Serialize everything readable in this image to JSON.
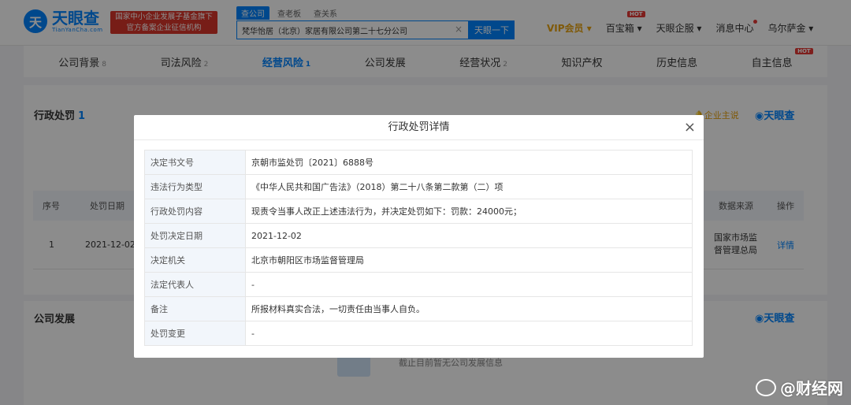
{
  "header": {
    "logo_mark": "天",
    "logo_text": "天眼查",
    "logo_sub": "TianYanCha.com",
    "banner_line1": "国家中小企业发展子基金旗下",
    "banner_line2": "官方备案企业征信机构",
    "search_tabs": [
      "查公司",
      "查老板",
      "查关系"
    ],
    "search_value": "梵华怡居（北京）家居有限公司第二十七分公司",
    "search_button": "天眼一下",
    "nav": {
      "vip": "VIP会员 ▾",
      "baibaoxiang": "百宝箱 ▾",
      "qifu": "天眼企服 ▾",
      "messages": "消息中心",
      "user": "乌尔萨金 ▾",
      "hot": "HOT"
    }
  },
  "company_tabs": [
    {
      "label": "公司背景",
      "count": "8"
    },
    {
      "label": "司法风险",
      "count": "2"
    },
    {
      "label": "经营风险",
      "count": "1"
    },
    {
      "label": "公司发展",
      "count": ""
    },
    {
      "label": "经营状况",
      "count": "2"
    },
    {
      "label": "知识产权",
      "count": ""
    },
    {
      "label": "历史信息",
      "count": ""
    },
    {
      "label": "自主信息",
      "count": ""
    }
  ],
  "tab_hot": "HOT",
  "section_penalty": {
    "title": "行政处罚",
    "count": "1",
    "alert": "企业主说",
    "brand": "天眼查"
  },
  "table": {
    "headers": [
      "序号",
      "处罚日期",
      "数据来源",
      "操作"
    ],
    "row": {
      "index": "1",
      "date": "2021-12-02",
      "source_line1": "国家市场监",
      "source_line2": "督管理总局",
      "action": "详情"
    }
  },
  "section_dev": {
    "title": "公司发展",
    "brand": "天眼查",
    "empty_text": "截止目前暂无公司发展信息"
  },
  "modal": {
    "title": "行政处罚详情",
    "close": "×",
    "rows": [
      {
        "label": "决定书文号",
        "value": "京朝市监处罚〔2021〕6888号"
      },
      {
        "label": "违法行为类型",
        "value": "《中华人民共和国广告法》（2018）第二十八条第二款第（二）项"
      },
      {
        "label": "行政处罚内容",
        "value": "现责令当事人改正上述违法行为，并决定处罚如下：罚款：24000元；"
      },
      {
        "label": "处罚决定日期",
        "value": "2021-12-02"
      },
      {
        "label": "决定机关",
        "value": "北京市朝阳区市场监督管理局"
      },
      {
        "label": "法定代表人",
        "value": "-"
      },
      {
        "label": "备注",
        "value": "所报材料真实合法，一切责任由当事人自负。"
      },
      {
        "label": "处罚变更",
        "value": "-"
      }
    ]
  },
  "watermark": "@财经网"
}
